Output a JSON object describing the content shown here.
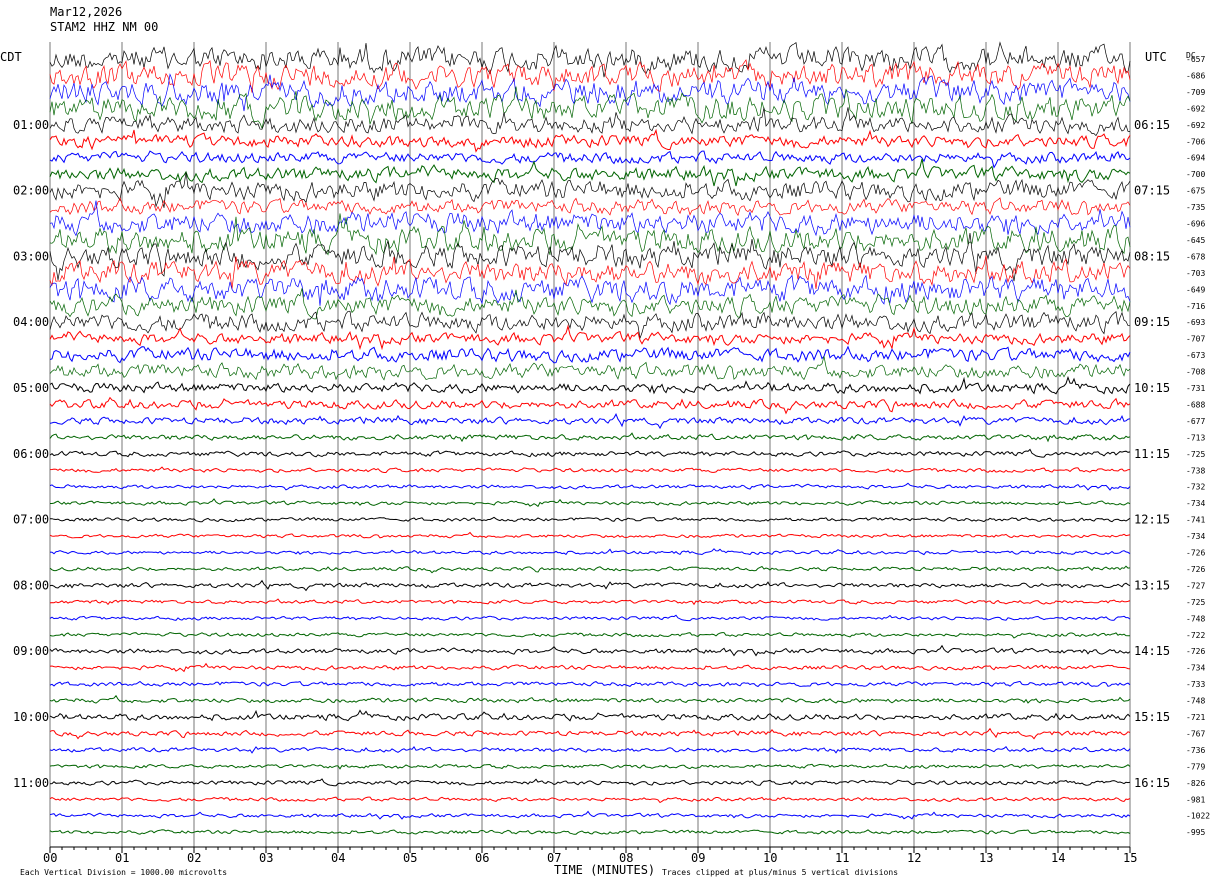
{
  "header": {
    "date": "Mar12,2026",
    "station": "STAM2 HHZ NM 00"
  },
  "left_timezone": "CDT",
  "right_timezone": "UTC",
  "dc_header": "DC",
  "footer": {
    "scale_note": "Each Vertical Division = 1000.00 microvolts",
    "clip_note": "Traces clipped at plus/minus 5 vertical divisions"
  },
  "colors": {
    "trace_cycle": [
      "#000000",
      "#ff0000",
      "#0000ff",
      "#006400"
    ],
    "grid": "#000000",
    "background": "#ffffff"
  },
  "chart_data": {
    "type": "line",
    "title": "",
    "xlabel": "TIME (MINUTES)",
    "ylabel": "",
    "xlim": [
      0,
      15
    ],
    "x_ticks": [
      "00",
      "01",
      "02",
      "03",
      "04",
      "05",
      "06",
      "07",
      "08",
      "09",
      "10",
      "11",
      "12",
      "13",
      "14",
      "15"
    ],
    "grid": true,
    "left_hour_labels": [
      "01:00",
      "02:00",
      "03:00",
      "04:00",
      "05:00",
      "06:00",
      "07:00",
      "08:00",
      "09:00",
      "10:00",
      "11:00"
    ],
    "right_hour_labels": [
      "06:15",
      "07:15",
      "08:15",
      "09:15",
      "10:15",
      "11:15",
      "12:15",
      "13:15",
      "14:15",
      "15:15",
      "16:15"
    ],
    "dc_offsets": [
      "-657",
      "-686",
      "-709",
      "-692",
      "-692",
      "-706",
      "-694",
      "-700",
      "-675",
      "-735",
      "-696",
      "-645",
      "-678",
      "-703",
      "-649",
      "-716",
      "-693",
      "-707",
      "-673",
      "-708",
      "-731",
      "-688",
      "-677",
      "-713",
      "-725",
      "-738",
      "-732",
      "-734",
      "-741",
      "-734",
      "-726",
      "-726",
      "-727",
      "-725",
      "-748",
      "-722",
      "-726",
      "-734",
      "-733",
      "-748",
      "-721",
      "-767",
      "-736",
      "-779",
      "-826",
      "-981",
      "-1022",
      "-995"
    ],
    "trace_count": 48,
    "trace_interval_minutes": 15,
    "trace_relative_amplitude": [
      2.0,
      2.0,
      2.0,
      2.0,
      1.4,
      1.0,
      0.9,
      1.1,
      1.6,
      1.2,
      1.8,
      2.0,
      1.9,
      1.9,
      2.0,
      1.6,
      1.5,
      0.9,
      1.1,
      1.2,
      0.8,
      0.7,
      0.55,
      0.45,
      0.4,
      0.32,
      0.3,
      0.3,
      0.3,
      0.28,
      0.28,
      0.3,
      0.38,
      0.3,
      0.28,
      0.3,
      0.4,
      0.35,
      0.35,
      0.38,
      0.5,
      0.4,
      0.35,
      0.3,
      0.35,
      0.3,
      0.3,
      0.3
    ],
    "clip_divisions": 5,
    "division_microvolts": 1000.0
  }
}
